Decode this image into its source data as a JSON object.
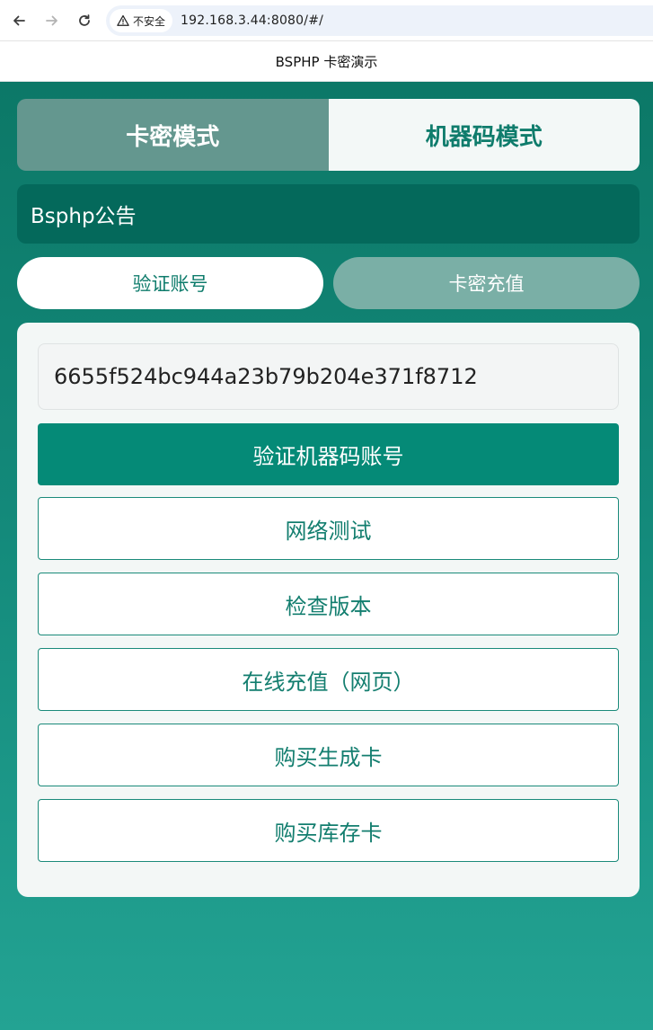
{
  "browser": {
    "security_label": "不安全",
    "url": "192.168.3.44:8080/#/"
  },
  "page": {
    "title": "BSPHP 卡密演示"
  },
  "mode_tabs": [
    {
      "label": "卡密模式",
      "active": false
    },
    {
      "label": "机器码模式",
      "active": true
    }
  ],
  "notice": {
    "text": "Bsphp公告"
  },
  "sub_tabs": [
    {
      "label": "验证账号",
      "active": true
    },
    {
      "label": "卡密充值",
      "active": false
    }
  ],
  "form": {
    "machine_code_value": "6655f524bc944a23b79b204e371f8712",
    "verify_button": "验证机器码账号",
    "buttons": [
      {
        "label": "网络测试"
      },
      {
        "label": "检查版本"
      },
      {
        "label": "在线充值（网页）"
      },
      {
        "label": "购买生成卡"
      },
      {
        "label": "购买库存卡"
      }
    ]
  },
  "colors": {
    "accent": "#058a77",
    "header_bg": "#0c7867",
    "notice_bg": "#04695b"
  }
}
